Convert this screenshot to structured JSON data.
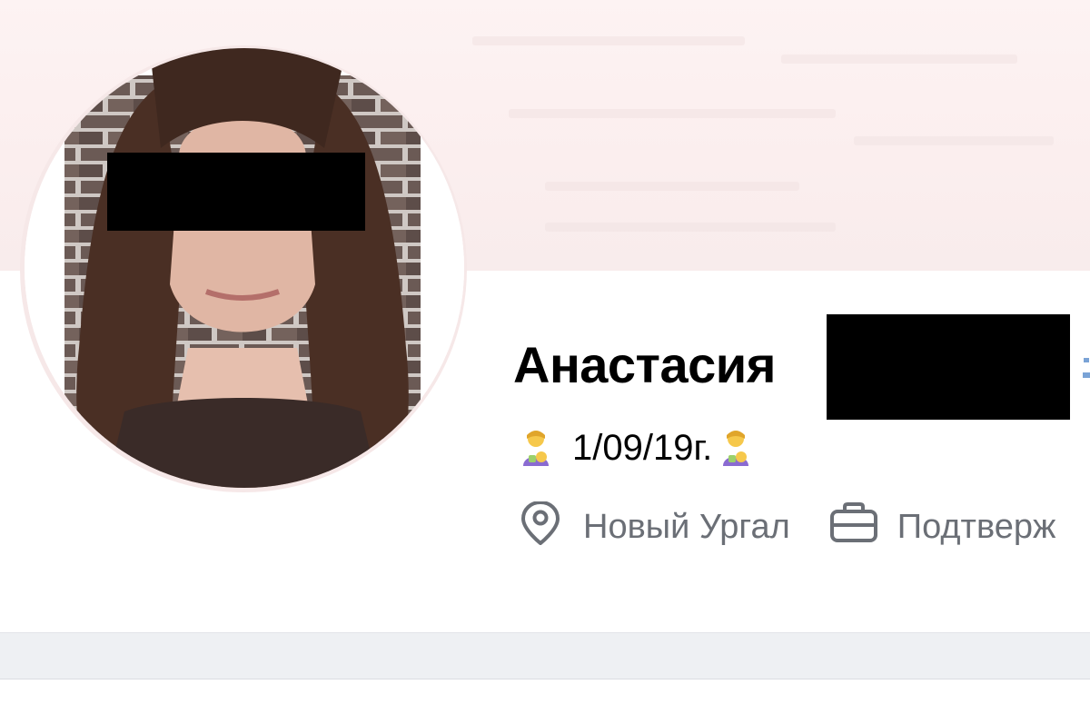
{
  "profile": {
    "first_name": "Анастасия",
    "status_text": "1/09/19г.",
    "status_emoji": "woman-feeding-baby-emoji",
    "location_icon": "map-pin-icon",
    "location": "Новый Ургал",
    "work_icon": "briefcase-icon",
    "work": "Подтверж"
  },
  "colors": {
    "cover": "#fbeeee",
    "secondary_text": "#6b6f76",
    "divider": "#eef0f3",
    "censor": "#000000"
  }
}
